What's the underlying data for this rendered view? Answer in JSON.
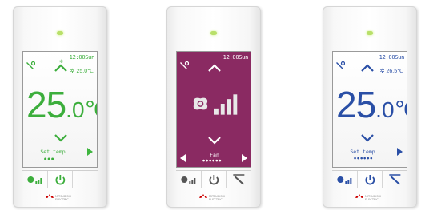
{
  "units": [
    {
      "variant": "heat-green",
      "clock": "12:00Sun",
      "temp_integer": "25",
      "temp_decimal": ".0",
      "temp_unit": "℃",
      "set_temp": "25.0℃",
      "caption": "Set temp.",
      "page_dots": "●●●",
      "color_accent": "#3cae3c"
    },
    {
      "variant": "fan-purple",
      "clock": "12:00Sun",
      "caption": "Fan",
      "page_dots": "●●●●●●",
      "color_accent": "#ffffff"
    },
    {
      "variant": "cool-blue",
      "clock": "12:00Sun",
      "temp_integer": "25",
      "temp_decimal": ".0",
      "temp_unit": "℃",
      "set_temp": "26.5℃",
      "caption": "Set temp.",
      "page_dots": "●●●●●●",
      "color_accent": "#2a4fa6"
    }
  ],
  "brand": {
    "line1": "MITSUBISHI",
    "line2": "ELECTRIC"
  },
  "icons": {
    "maintenance": "wrench-icon",
    "fan_speed": "fan-speed-icon",
    "power": "power-icon",
    "vane": "vane-icon",
    "heat": "sun-icon"
  }
}
